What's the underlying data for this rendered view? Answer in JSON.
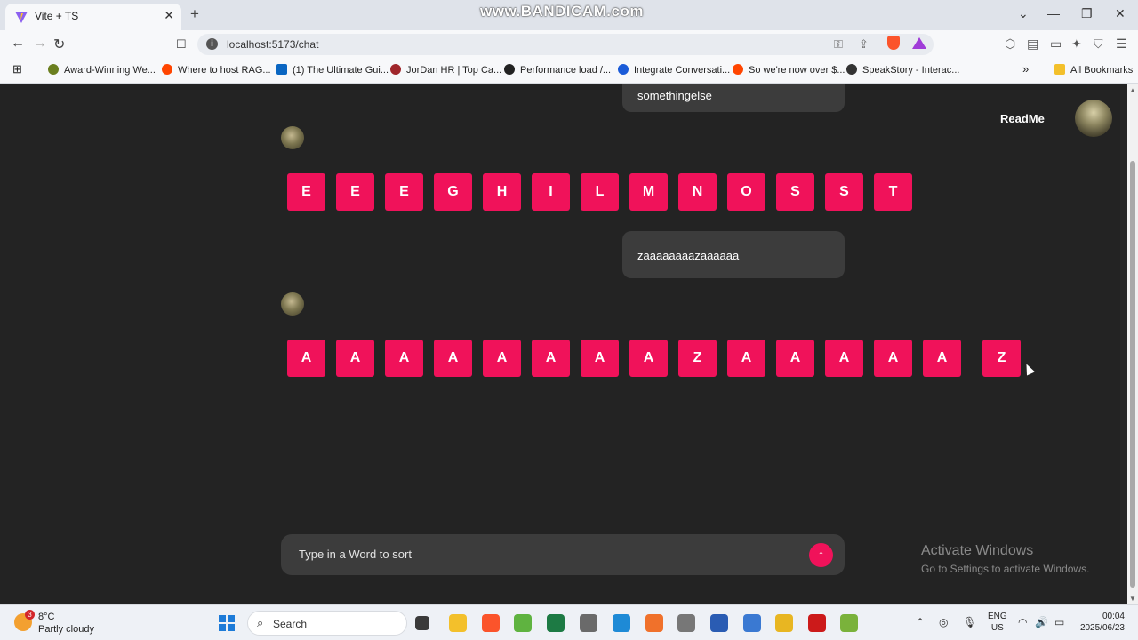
{
  "browser": {
    "tab_title": "Vite + TS",
    "tab_close": "✕",
    "new_tab": "+",
    "watermark": "www.BANDICAM.com",
    "win_minimize": "—",
    "win_restore": "❐",
    "win_close": "✕",
    "win_dropdown": "⌄",
    "url": "localhost:5173/chat",
    "info_glyph": "i",
    "nav": {
      "back": "←",
      "forward": "→",
      "reload": "↻",
      "bookmark": "☐"
    }
  },
  "bookmarks": {
    "items": [
      {
        "label": "Award-Winning We...",
        "color": "#6b7f1f"
      },
      {
        "label": "Where to host RAG...",
        "color": "#ff4500"
      },
      {
        "label": "(1) The Ultimate Gui...",
        "color": "#0a66c2"
      },
      {
        "label": "JorDan HR | Top Ca...",
        "color": "#a0262b"
      },
      {
        "label": "Performance load /...",
        "color": "#222222"
      },
      {
        "label": "Integrate Conversati...",
        "color": "#1a5bd8"
      },
      {
        "label": "So we're now over $...",
        "color": "#ff4500"
      },
      {
        "label": "SpeakStory - Interac...",
        "color": "#333333"
      }
    ],
    "overflow": "»",
    "all_bookmarks": "All Bookmarks"
  },
  "chat": {
    "header": {
      "readme": "ReadMe"
    },
    "messages": [
      {
        "text": "somethingelse"
      },
      {
        "text": "zaaaaaaaazaaaaaa"
      }
    ],
    "results": [
      [
        "E",
        "E",
        "E",
        "G",
        "H",
        "I",
        "L",
        "M",
        "N",
        "O",
        "S",
        "S",
        "T"
      ],
      [
        "A",
        "A",
        "A",
        "A",
        "A",
        "A",
        "A",
        "A",
        "Z",
        "A",
        "A",
        "A",
        "A",
        "A",
        "Z"
      ]
    ],
    "input": {
      "placeholder": "Type in a Word to sort",
      "value": ""
    },
    "send_glyph": "↑"
  },
  "overlay": {
    "activate_title": "Activate Windows",
    "activate_sub": "Go to Settings to activate Windows."
  },
  "taskbar": {
    "weather_badge": "3",
    "weather_temp": "8°C",
    "weather_cond": "Partly cloudy",
    "search_label": "Search",
    "lang_1": "ENG",
    "lang_2": "US",
    "time": "00:04",
    "date": "2025/06/23",
    "apps": [
      {
        "name": "file-explorer-icon",
        "color": "#f3c02b"
      },
      {
        "name": "brave-icon",
        "color": "#fb542b"
      },
      {
        "name": "utorrent-icon",
        "color": "#5fb340"
      },
      {
        "name": "excel-icon",
        "color": "#1d7a44"
      },
      {
        "name": "clock-app-icon",
        "color": "#6a6a6a"
      },
      {
        "name": "vscode-icon",
        "color": "#1e8ad6"
      },
      {
        "name": "postman-icon",
        "color": "#f0712b"
      },
      {
        "name": "network-icon",
        "color": "#777777"
      },
      {
        "name": "word-icon",
        "color": "#2a5cb3"
      },
      {
        "name": "snipping-icon",
        "color": "#3a79d2"
      },
      {
        "name": "warning-icon",
        "color": "#e8b622"
      },
      {
        "name": "bandicam-icon",
        "color": "#cc1a1a"
      },
      {
        "name": "notepad-plus-icon",
        "color": "#7ab23b"
      }
    ]
  }
}
